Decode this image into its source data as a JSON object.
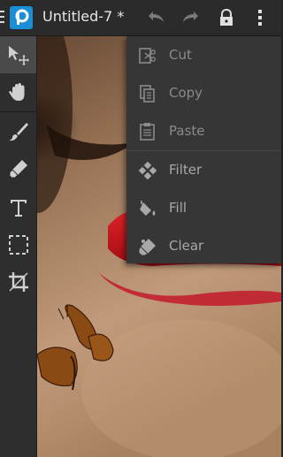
{
  "app": {
    "document_title": "Untitled-7 *",
    "logo_letter": "p"
  },
  "titlebar": {
    "icons": [
      "menu-lines-icon",
      "app-logo-icon",
      "undo-icon",
      "redo-icon",
      "lock-icon",
      "overflow-menu-icon"
    ]
  },
  "toolbar": {
    "tools": [
      {
        "name": "move-tool",
        "icon": "move-arrow-icon",
        "active": true
      },
      {
        "name": "pan-tool",
        "icon": "hand-icon",
        "active": false
      },
      {
        "name": "brush-tool",
        "icon": "brush-icon",
        "active": false
      },
      {
        "name": "eraser-tool",
        "icon": "eraser-icon",
        "active": false
      },
      {
        "name": "text-tool",
        "icon": "text-icon",
        "label": "T",
        "active": false
      },
      {
        "name": "selection-tool",
        "icon": "marquee-icon",
        "active": false
      },
      {
        "name": "crop-tool",
        "icon": "crop-icon",
        "active": false
      }
    ]
  },
  "popup_menu": {
    "items": [
      {
        "label": "Cut",
        "icon": "scissors-icon",
        "enabled": false
      },
      {
        "label": "Copy",
        "icon": "copy-icon",
        "enabled": false
      },
      {
        "label": "Paste",
        "icon": "clipboard-icon",
        "enabled": false
      },
      {
        "label": "Filter",
        "icon": "filter-icon",
        "enabled": true
      },
      {
        "label": "Fill",
        "icon": "fill-bucket-icon",
        "enabled": true
      },
      {
        "label": "Clear",
        "icon": "eraser-clear-icon",
        "enabled": true
      }
    ]
  },
  "colors": {
    "accent": "#1b8fd6",
    "lips": "#d8141c",
    "menu_bg": "#363636"
  }
}
